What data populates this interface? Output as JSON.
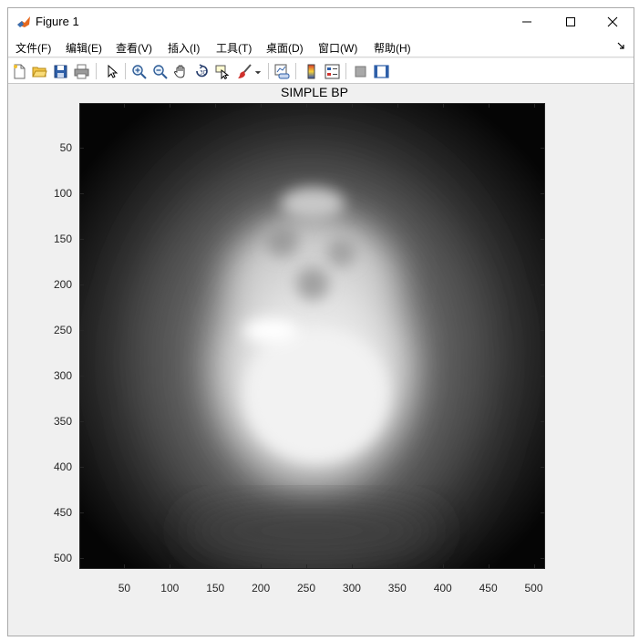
{
  "window": {
    "title": "Figure 1",
    "controls": [
      "minimize",
      "maximize",
      "close"
    ]
  },
  "menubar": {
    "items": [
      {
        "label": "文件(F)"
      },
      {
        "label": "编辑(E)"
      },
      {
        "label": "查看(V)"
      },
      {
        "label": "插入(I)"
      },
      {
        "label": "工具(T)"
      },
      {
        "label": "桌面(D)"
      },
      {
        "label": "窗口(W)"
      },
      {
        "label": "帮助(H)"
      }
    ]
  },
  "toolbar": {
    "buttons": [
      "new-figure-icon",
      "open-file-icon",
      "save-icon",
      "print-icon",
      "select-arrow-icon",
      "zoom-in-icon",
      "zoom-out-icon",
      "pan-hand-icon",
      "rotate-3d-icon",
      "data-cursor-icon",
      "brush-icon",
      "link-plot-icon",
      "insert-colorbar-icon",
      "insert-legend-icon",
      "hide-plot-tools-icon",
      "show-plot-tools-icon"
    ]
  },
  "plot": {
    "title": "SIMPLE BP",
    "colormap": "gray",
    "image_size": [
      512,
      512
    ],
    "x_ticks": [
      "50",
      "100",
      "150",
      "200",
      "250",
      "300",
      "350",
      "400",
      "450",
      "500"
    ],
    "y_ticks": [
      "50",
      "100",
      "150",
      "200",
      "250",
      "300",
      "350",
      "400",
      "450",
      "500"
    ],
    "x_range": [
      0.5,
      512.5
    ],
    "y_range": [
      0.5,
      512.5
    ],
    "y_direction": "reverse"
  }
}
